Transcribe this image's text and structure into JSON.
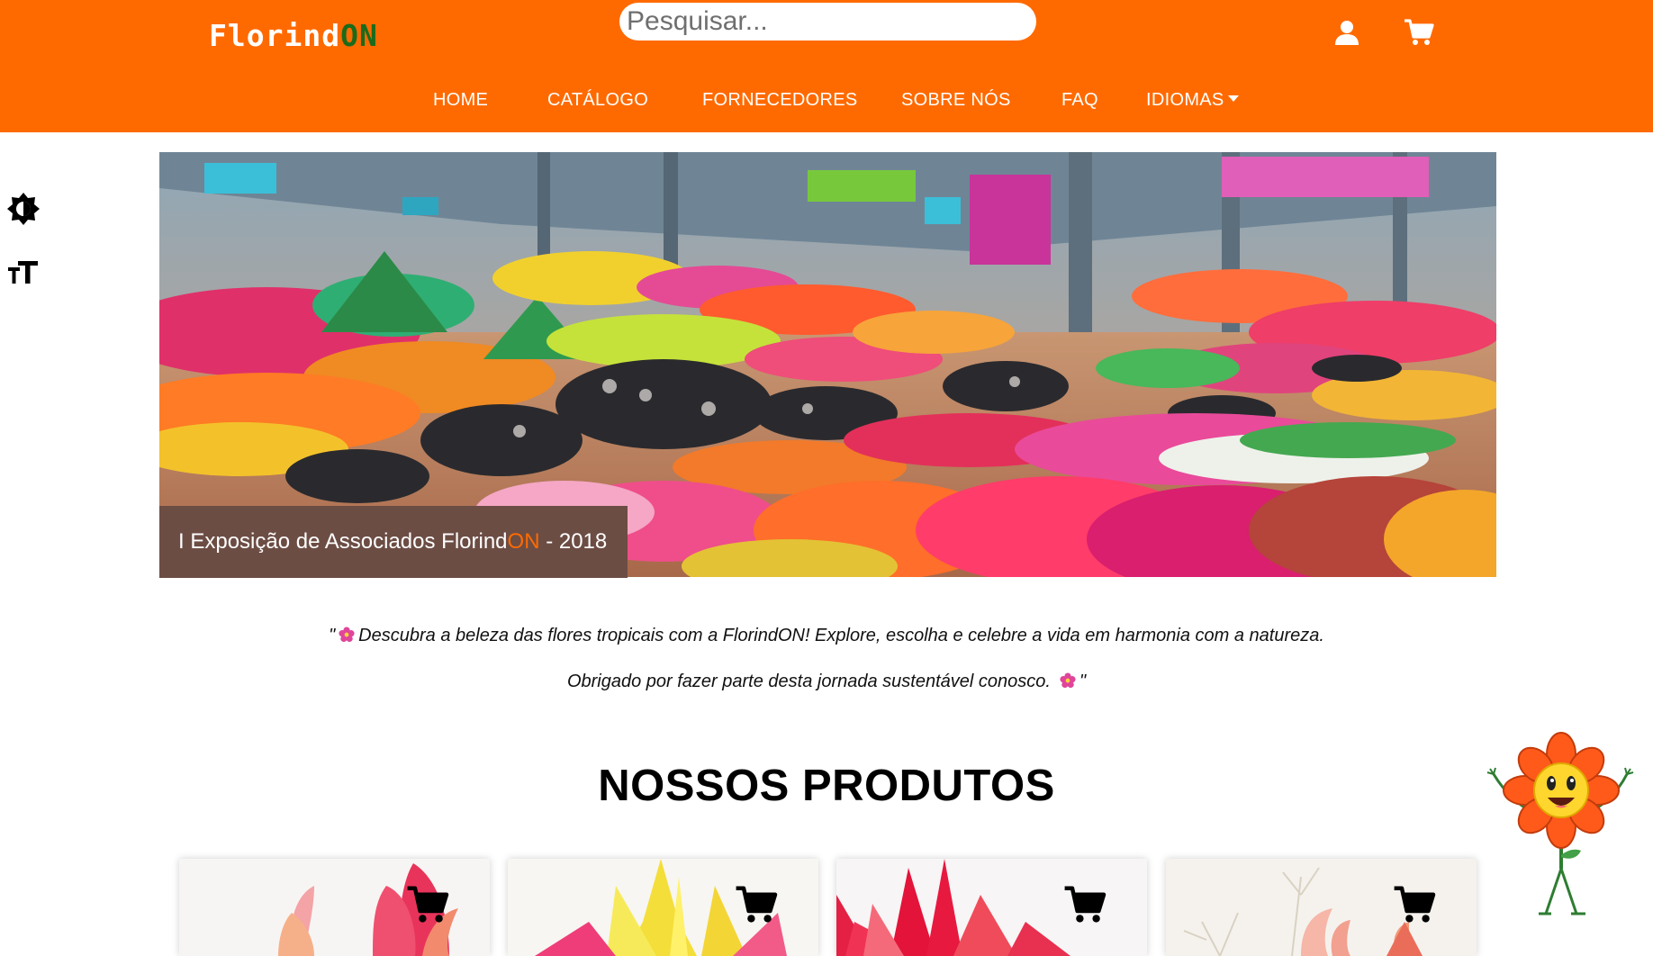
{
  "header": {
    "logo_part1": "Florind",
    "logo_part2": "ON",
    "search_placeholder": "Pesquisar...",
    "user_icon": "user-icon",
    "cart_icon": "cart-icon"
  },
  "nav": {
    "items": [
      "HOME",
      "CATÁLOGO",
      "FORNECEDORES",
      "SOBRE NÓS",
      "FAQ",
      "IDIOMAS"
    ]
  },
  "accessibility": {
    "contrast_icon": "contrast-icon",
    "font_size_icon": "font-size-icon"
  },
  "hero": {
    "caption_part1": "I Exposição de Associados Florind",
    "caption_part2": "ON",
    "caption_part3": " - 2018"
  },
  "quote": {
    "line1_open": "\"",
    "line1_text": "Descubra a beleza das flores tropicais com a FlorindON! Explore, escolha e celebre a vida em harmonia com a natureza.",
    "line2_text": "Obrigado por fazer parte desta jornada sustentável conosco.",
    "line2_close": "\""
  },
  "products": {
    "title": "NOSSOS PRODUTOS",
    "cards": [
      {
        "cart_icon": "cart-icon"
      },
      {
        "cart_icon": "cart-icon"
      },
      {
        "cart_icon": "cart-icon"
      },
      {
        "cart_icon": "cart-icon"
      }
    ]
  },
  "colors": {
    "brand_orange": "#ff6a00",
    "logo_green": "#1b6b1b",
    "caption_bg": "#6c4d44"
  }
}
